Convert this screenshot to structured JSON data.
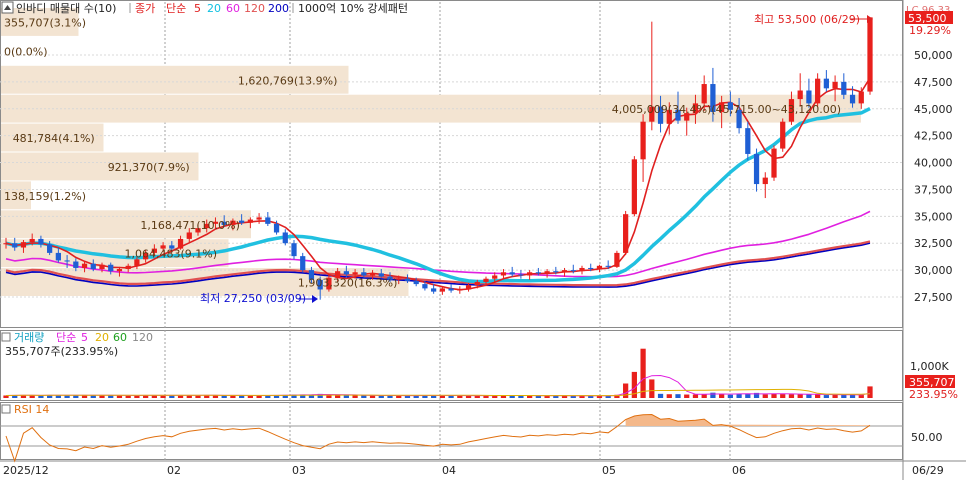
{
  "legend": {
    "title": "인바디 매물대 수(10)",
    "price": "종가",
    "ma_type": "단순",
    "ma_periods": [
      "5",
      "20",
      "60",
      "120",
      "200"
    ],
    "ma_colors": [
      "#e02020",
      "#20c0e0",
      "#e020e0",
      "#e05050",
      "#0000c0"
    ],
    "extra": "1000억 10% 강세패턴"
  },
  "price_axis": {
    "ticks": [
      "50,000",
      "47,500",
      "45,000",
      "42,500",
      "40,000",
      "37,500",
      "35,000",
      "32,500",
      "30,000",
      "27,500"
    ],
    "lc_label": "LC 96.33",
    "current_price": "53,500",
    "current_pct": "19.29%"
  },
  "annotations": {
    "high": "최고 53,500 (06/29)",
    "low": "최저 27,250 (03/09)"
  },
  "volume_profile": [
    {
      "label": "355,707(3.1%)"
    },
    {
      "label": "0(0.0%)"
    },
    {
      "label": "1,620,769(13.9%)"
    },
    {
      "label": "4,005,009(34.4%)(45,715.00~43,120.00)"
    },
    {
      "label": "481,784(4.1%)"
    },
    {
      "label": "921,370(7.9%)"
    },
    {
      "label": "138,159(1.2%)"
    },
    {
      "label": "1,168,471(10.0%)"
    },
    {
      "label": "1,064,483(9.1%)"
    },
    {
      "label": "1,903,320(16.3%)"
    }
  ],
  "volume_panel": {
    "title": "거래량",
    "ma_type": "단순",
    "ma_periods": [
      "5",
      "20",
      "60",
      "120"
    ],
    "ma_colors": [
      "#e020e0",
      "#e0b000",
      "#20a020",
      "#888888"
    ],
    "current": "355,707주(233.95%)",
    "tick": "1,000K",
    "value": "355,707",
    "value_pct": "233.95%"
  },
  "rsi_panel": {
    "title": "RSI 14",
    "tick": "50.00"
  },
  "date_axis": [
    "2025/12",
    "02",
    "03",
    "04",
    "05",
    "06",
    "06/29"
  ],
  "chart_data": {
    "type": "candlestick",
    "price_axis_range": [
      25500,
      53500
    ],
    "last_close": 53500,
    "high": {
      "value": 53500,
      "date": "06/29"
    },
    "low": {
      "value": 27250,
      "date": "03/09"
    },
    "volume_by_price": [
      {
        "volume": 355707,
        "pct": 3.1
      },
      {
        "volume": 0,
        "pct": 0.0
      },
      {
        "volume": 1620769,
        "pct": 13.9
      },
      {
        "volume": 4005009,
        "pct": 34.4,
        "range": [
          43120,
          45715
        ]
      },
      {
        "volume": 481784,
        "pct": 4.1
      },
      {
        "volume": 921370,
        "pct": 7.9
      },
      {
        "volume": 138159,
        "pct": 1.2
      },
      {
        "volume": 1168471,
        "pct": 10.0
      },
      {
        "volume": 1064483,
        "pct": 9.1
      },
      {
        "volume": 1903320,
        "pct": 16.3
      }
    ],
    "last_volume": 355707,
    "last_volume_pct": 233.95,
    "rsi_period": 14,
    "daily_ohlc": [
      [
        32400,
        33000,
        32000,
        32500
      ],
      [
        32500,
        33000,
        31800,
        32100
      ],
      [
        32100,
        32800,
        31600,
        32600
      ],
      [
        32600,
        33400,
        32300,
        32900
      ],
      [
        32900,
        33200,
        32100,
        32400
      ],
      [
        32400,
        32700,
        31400,
        31600
      ],
      [
        31600,
        32100,
        30700,
        30900
      ],
      [
        30900,
        31400,
        30200,
        30800
      ],
      [
        30800,
        31100,
        29900,
        30200
      ],
      [
        30200,
        30800,
        29800,
        30600
      ],
      [
        30600,
        31000,
        29900,
        30100
      ],
      [
        30100,
        30700,
        29800,
        30500
      ],
      [
        30500,
        30700,
        29600,
        29900
      ],
      [
        29900,
        30300,
        29400,
        30100
      ],
      [
        30100,
        30600,
        29800,
        30400
      ],
      [
        30400,
        31200,
        30100,
        31000
      ],
      [
        31000,
        31900,
        30700,
        31600
      ],
      [
        31600,
        32400,
        31300,
        32000
      ],
      [
        32000,
        32600,
        31700,
        32300
      ],
      [
        32300,
        32700,
        31800,
        32000
      ],
      [
        32000,
        33200,
        31900,
        32900
      ],
      [
        32900,
        33900,
        32600,
        33500
      ],
      [
        33500,
        34300,
        33200,
        33900
      ],
      [
        33900,
        34700,
        33500,
        34300
      ],
      [
        34300,
        34900,
        33800,
        34500
      ],
      [
        34500,
        35100,
        34000,
        34200
      ],
      [
        34200,
        34800,
        33700,
        34600
      ],
      [
        34600,
        35200,
        34200,
        34400
      ],
      [
        34400,
        34900,
        33900,
        34700
      ],
      [
        34700,
        35300,
        34300,
        34900
      ],
      [
        34900,
        35400,
        34100,
        34300
      ],
      [
        34300,
        34600,
        33300,
        33500
      ],
      [
        33500,
        33800,
        32300,
        32500
      ],
      [
        32500,
        32800,
        31000,
        31300
      ],
      [
        31300,
        31600,
        29800,
        30000
      ],
      [
        30000,
        30300,
        28800,
        29100
      ],
      [
        29100,
        29400,
        27250,
        28200
      ],
      [
        28200,
        29600,
        28000,
        29300
      ],
      [
        29300,
        30200,
        28900,
        29900
      ],
      [
        29900,
        30400,
        29300,
        29600
      ],
      [
        29600,
        30100,
        29200,
        29800
      ],
      [
        29800,
        30200,
        29300,
        29500
      ],
      [
        29500,
        30000,
        29100,
        29700
      ],
      [
        29700,
        30100,
        29300,
        29400
      ],
      [
        29400,
        29800,
        28900,
        29100
      ],
      [
        29100,
        29500,
        28700,
        29200
      ],
      [
        29200,
        29600,
        28800,
        29000
      ],
      [
        29000,
        29300,
        28500,
        28700
      ],
      [
        28700,
        29000,
        28100,
        28300
      ],
      [
        28300,
        28700,
        27800,
        28000
      ],
      [
        28000,
        28500,
        27700,
        28300
      ],
      [
        28300,
        28700,
        27900,
        28100
      ],
      [
        28100,
        28500,
        27800,
        28200
      ],
      [
        28200,
        28800,
        28000,
        28600
      ],
      [
        28600,
        29100,
        28300,
        28900
      ],
      [
        28900,
        29400,
        28600,
        29200
      ],
      [
        29200,
        29800,
        28900,
        29500
      ],
      [
        29500,
        30100,
        29200,
        29800
      ],
      [
        29800,
        30300,
        29400,
        29600
      ],
      [
        29600,
        30000,
        29200,
        29500
      ],
      [
        29500,
        30000,
        29100,
        29800
      ],
      [
        29800,
        30200,
        29500,
        29700
      ],
      [
        29700,
        30100,
        29300,
        29900
      ],
      [
        29900,
        30300,
        29600,
        29800
      ],
      [
        29800,
        30200,
        29400,
        30000
      ],
      [
        30000,
        30500,
        29700,
        29900
      ],
      [
        29900,
        30400,
        29600,
        30200
      ],
      [
        30200,
        30600,
        29900,
        30100
      ],
      [
        30100,
        30500,
        29800,
        30400
      ],
      [
        30400,
        30900,
        30100,
        30300
      ],
      [
        30300,
        31800,
        30200,
        31600
      ],
      [
        31600,
        35500,
        31400,
        35200
      ],
      [
        35200,
        40600,
        35000,
        40300
      ],
      [
        40300,
        44500,
        38200,
        43800
      ],
      [
        43800,
        53100,
        43000,
        45200
      ],
      [
        45200,
        46200,
        42800,
        43600
      ],
      [
        43600,
        45600,
        42600,
        44900
      ],
      [
        44900,
        46600,
        43600,
        43900
      ],
      [
        43900,
        45100,
        42500,
        44600
      ],
      [
        44600,
        46300,
        43600,
        45500
      ],
      [
        45500,
        48100,
        44800,
        47300
      ],
      [
        47300,
        48800,
        43800,
        44700
      ],
      [
        44700,
        46200,
        43200,
        45600
      ],
      [
        45600,
        46600,
        44300,
        44900
      ],
      [
        44900,
        46000,
        42700,
        43200
      ],
      [
        43200,
        43800,
        40200,
        40800
      ],
      [
        40800,
        41300,
        37300,
        38000
      ],
      [
        38000,
        39100,
        36700,
        38600
      ],
      [
        38600,
        41600,
        38300,
        41300
      ],
      [
        41300,
        44100,
        41000,
        43800
      ],
      [
        43800,
        46600,
        43500,
        45900
      ],
      [
        45900,
        48300,
        45200,
        46700
      ],
      [
        46700,
        47800,
        45100,
        45500
      ],
      [
        45500,
        48300,
        45200,
        47800
      ],
      [
        47800,
        48600,
        46600,
        46900
      ],
      [
        46900,
        48100,
        45700,
        47500
      ],
      [
        47500,
        48300,
        45900,
        46300
      ],
      [
        46300,
        47100,
        45100,
        45500
      ],
      [
        45500,
        47000,
        45000,
        46600
      ],
      [
        46600,
        53500,
        46300,
        53500
      ]
    ]
  }
}
